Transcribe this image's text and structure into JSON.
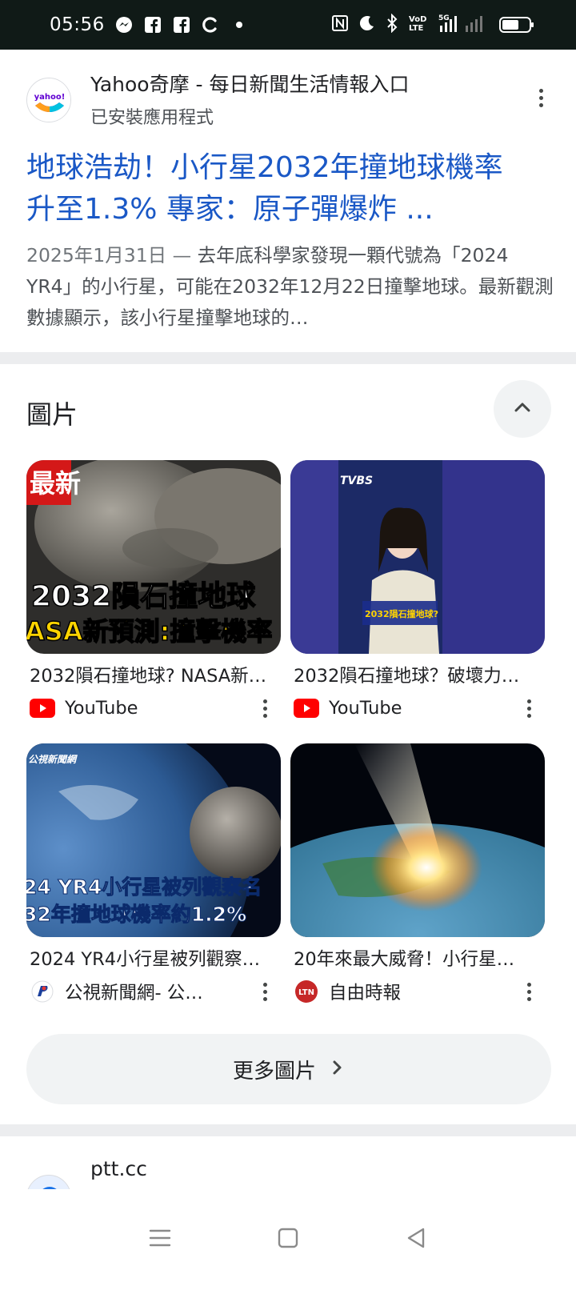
{
  "status_bar": {
    "time": "05:56",
    "network": "5G",
    "volte": "VoLTE",
    "notification_icons": [
      "messenger-icon",
      "facebook-icon",
      "facebook-icon",
      "c-app-icon",
      "dot-icon"
    ],
    "system_icons": [
      "nfc-icon",
      "moon-icon",
      "bluetooth-icon",
      "volte-icon",
      "signal-icon",
      "battery-icon"
    ]
  },
  "result": {
    "site_name": "Yahoo奇摩 - 每日新聞生活情報入口",
    "site_sub": "已安裝應用程式",
    "logo_text": "yahoo!",
    "title_line1": "地球浩劫！小行星2032年撞地球機率",
    "title_line2": "升至1.3% 專家：原子彈爆炸 ...",
    "snippet_date": "2025年1月31日 — ",
    "snippet_body": "去年底科學家發現一顆代號為「2024 YR4」的小行星，可能在2032年12月22日撞擊地球。最新觀測數據顯示，該小行星撞擊地球的…"
  },
  "images_section": {
    "title": "圖片",
    "collapse_icon": "chevron-up-icon",
    "cards": [
      {
        "title": "2032隕石撞地球? NASA新…",
        "source": "YouTube",
        "source_icon": "youtube-icon",
        "thumb_text1": "2032隕石撞地球",
        "thumb_text2": "ASA新預測:撞擊機率",
        "thumb_badge": "最新"
      },
      {
        "title": "2032隕石撞地球？破壞力…",
        "source": "YouTube",
        "source_icon": "youtube-icon",
        "thumb_text1": "TVBS",
        "thumb_text2": "2032隕石撞地球?"
      },
      {
        "title": "2024 YR4小行星被列觀察…",
        "source": "公視新聞網- 公…",
        "source_icon": "pts-icon",
        "thumb_text1": "24 YR4小行星被列觀察名",
        "thumb_text2": "32年撞地球機率約1.2%",
        "thumb_badge": "公視新聞網"
      },
      {
        "title": "20年來最大威脅！小行星…",
        "source": "自由時報",
        "source_icon": "ltn-icon",
        "source_icon_text": "LTN"
      }
    ],
    "more_label": "更多圖片"
  },
  "next_result": {
    "site_name": "ptt.cc"
  },
  "colors": {
    "link_blue": "#1a58c6",
    "status_bar_bg": "#101a17",
    "youtube_red": "#ff0000",
    "chip_bg": "#f1f3f4"
  }
}
